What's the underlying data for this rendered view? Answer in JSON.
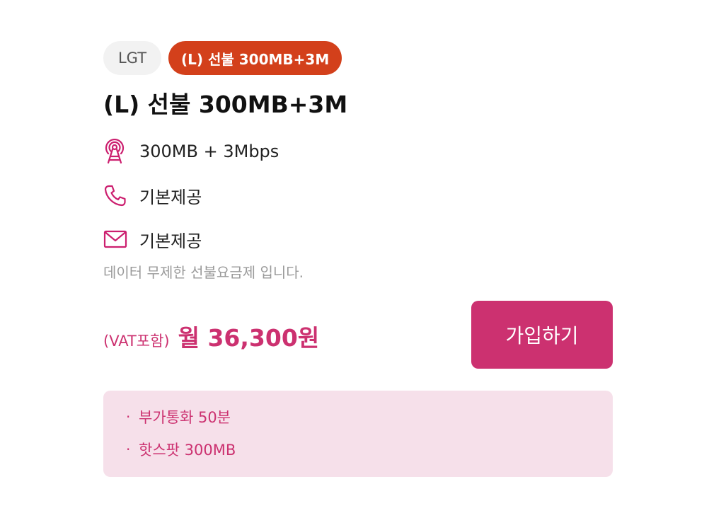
{
  "chips": {
    "carrier": "LGT",
    "plan": "(L) 선불 300MB+3M"
  },
  "title": "(L) 선불 300MB+3M",
  "features": [
    {
      "icon": "antenna-icon",
      "text": "300MB + 3Mbps"
    },
    {
      "icon": "phone-icon",
      "text": "기본제공"
    },
    {
      "icon": "mail-icon",
      "text": "기본제공"
    }
  ],
  "description": "데이터 무제한 선불요금제 입니다.",
  "price": {
    "vat_label": "(VAT포함)",
    "amount": "월 36,300원"
  },
  "join_button_label": "가입하기",
  "benefits": [
    {
      "bullet": "·",
      "text": "부가통화 50분"
    },
    {
      "bullet": "·",
      "text": "핫스팟 300MB"
    }
  ],
  "colors": {
    "accent": "#cc3170",
    "plan_chip": "#d3401b",
    "benefit_bg": "#f6e0ea"
  }
}
